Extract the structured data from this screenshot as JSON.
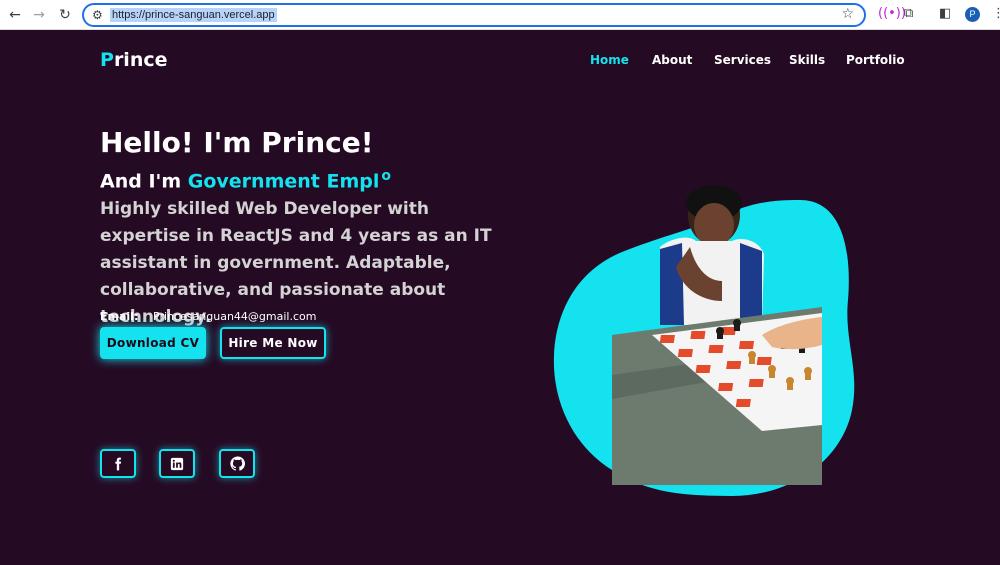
{
  "browser": {
    "url": "https://prince-sanguan.vercel.app",
    "profile_initial": "P"
  },
  "site": {
    "logo_first": "P",
    "logo_rest": "rince",
    "nav": [
      "Home",
      "About",
      "Services",
      "Skills",
      "Portfolio"
    ],
    "active_nav": "Home"
  },
  "hero": {
    "greeting": "Hello! I'm Prince!",
    "and_prefix": "And I'm ",
    "typed_text": "Government Empl",
    "typed_cursor": "o",
    "description": "Highly skilled Web Developer with expertise in ReactJS and 4 years as an IT assistant in government. Adaptable, collaborative, and passionate about technology.",
    "email_label": "Email:",
    "email": "Princesanguan44@gmail.com",
    "download_label": "Download CV",
    "hire_label": "Hire Me Now"
  },
  "social_icons": [
    "facebook-icon",
    "linkedin-icon",
    "github-icon"
  ],
  "colors": {
    "accent": "#14e3ef",
    "background": "#250a24"
  }
}
